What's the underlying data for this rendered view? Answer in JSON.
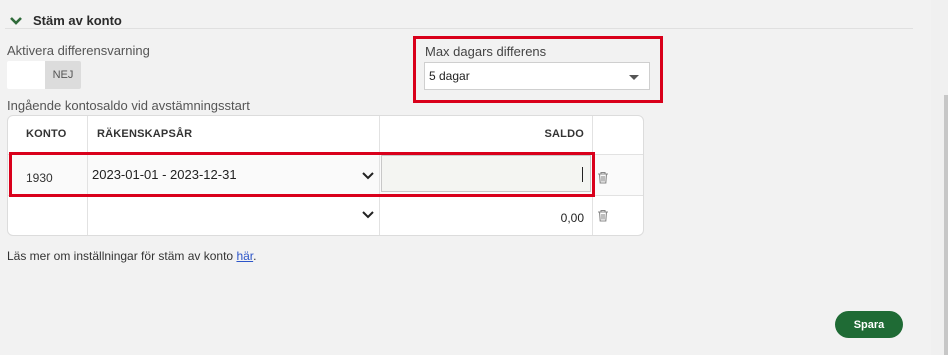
{
  "section": {
    "title": "Stäm av konto"
  },
  "diff_warning": {
    "label": "Aktivera differensvarning",
    "toggle_label": "NEJ"
  },
  "max_days": {
    "label": "Max dagars differens",
    "value": "5 dagar"
  },
  "opening_balance": {
    "label": "Ingående kontosaldo vid avstämningsstart"
  },
  "table": {
    "headers": {
      "konto": "KONTO",
      "year": "RÄKENSKAPSÅR",
      "saldo": "SALDO"
    },
    "rows": [
      {
        "konto": "1930",
        "year": "2023-01-01 - 2023-12-31",
        "saldo": ""
      },
      {
        "konto": "",
        "year": "",
        "saldo": "0,00"
      }
    ]
  },
  "footer": {
    "note": "Läs mer om inställningar för stäm av konto",
    "link": "här",
    "period": "."
  },
  "actions": {
    "save": "Spara"
  },
  "colors": {
    "accent_green": "#1f6b35",
    "highlight_red": "#d9001b",
    "link_blue": "#2c55c9"
  },
  "icons": [
    "chevron-down-icon",
    "caret-down-icon",
    "trash-icon"
  ]
}
